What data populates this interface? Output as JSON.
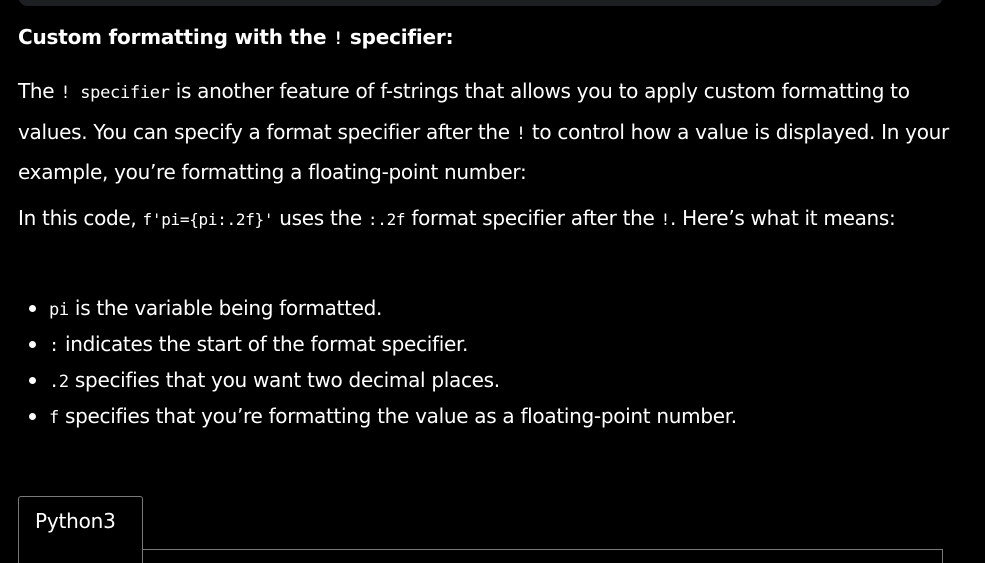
{
  "heading": {
    "text": "Custom formatting with the ",
    "code": "!",
    "suffix": " specifier:"
  },
  "paragraph1": {
    "t1": "The ",
    "c1": "! specifier",
    "t2": " is another feature of f-strings that allows you to apply custom formatting to values. You can specify a format specifier after the ",
    "c2": "!",
    "t3": " to control how a value is displayed. In your example, you’re formatting a floating-point number:"
  },
  "paragraph2": {
    "t1": "In this code, ",
    "c1": "f'pi={pi:.2f}'",
    "t2": " uses the ",
    "c2": ":.2f",
    "t3": " format specifier after the ",
    "c3": "!",
    "t4": ". Here’s what it means:"
  },
  "bullets": [
    {
      "code": "pi",
      "text": " is the variable being formatted."
    },
    {
      "code": ":",
      "text": " indicates the start of the format specifier."
    },
    {
      "code": ".2",
      "text": " specifies that you want two decimal places."
    },
    {
      "code": "f",
      "text": " specifies that you’re formatting the value as a floating-point number."
    }
  ],
  "code_tab": {
    "label": "Python3"
  }
}
